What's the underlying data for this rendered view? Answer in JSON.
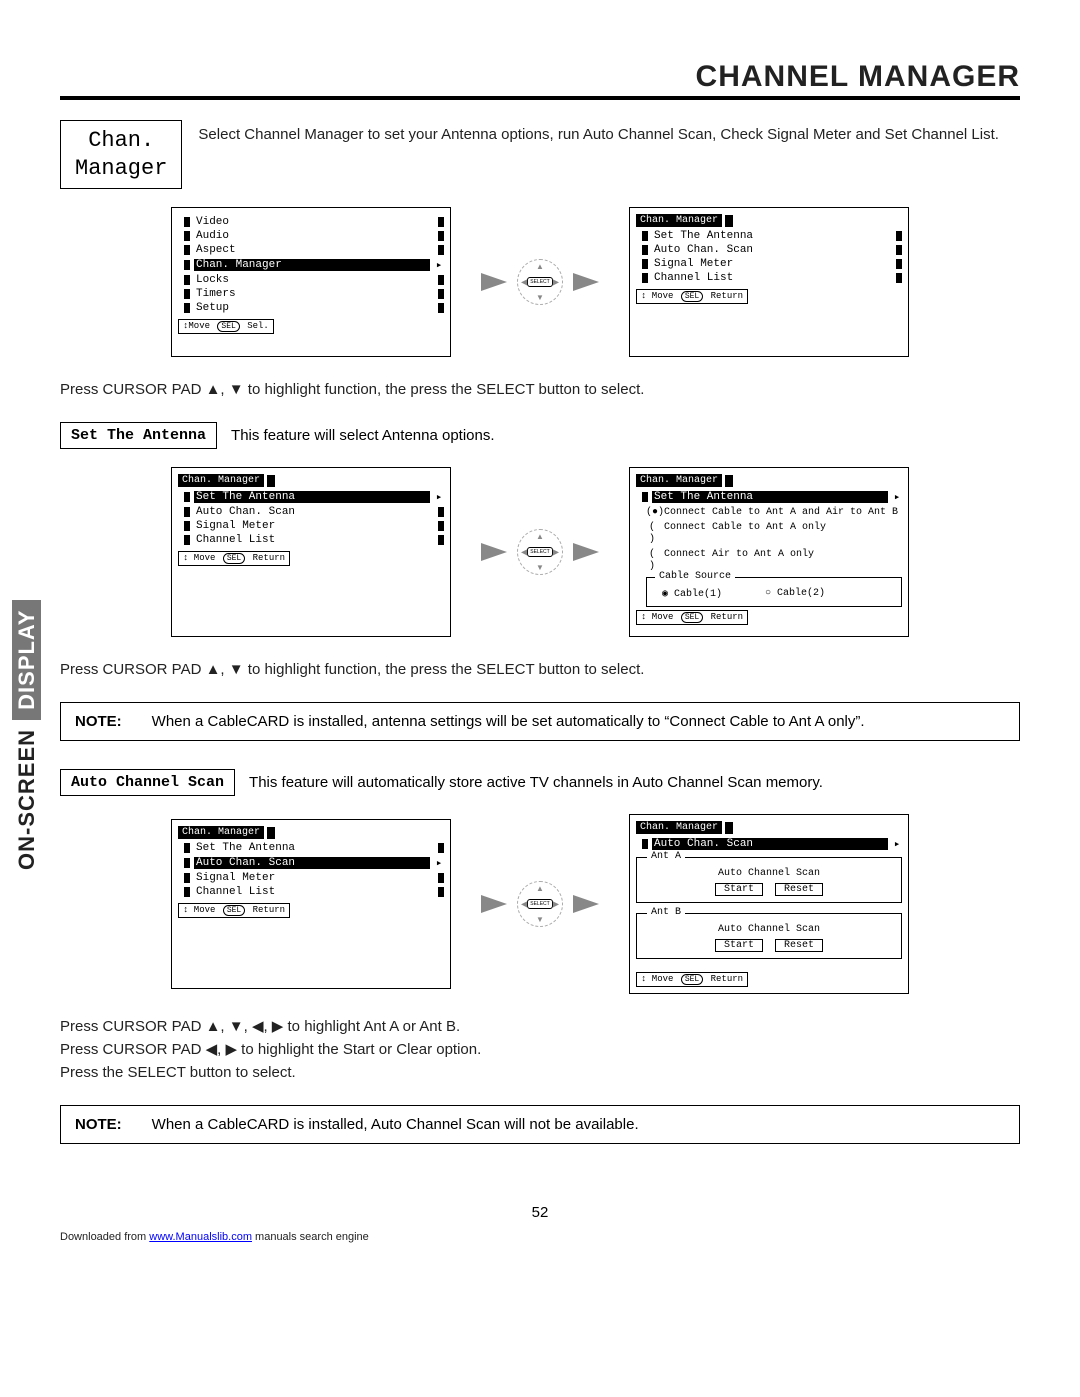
{
  "title": "CHANNEL MANAGER",
  "menu_label": "Chan.\nManager",
  "intro": "Select Channel Manager to set your Antenna options, run Auto Channel Scan, Check Signal Meter and Set Channel List.",
  "side_tab_prefix": "ON-SCREEN",
  "side_tab_suffix": "DISPLAY",
  "select_btn": "SELECT",
  "osd1_left": {
    "header": "",
    "items": [
      "Video",
      "Audio",
      "Aspect",
      "Chan. Manager",
      "Locks",
      "Timers",
      "Setup"
    ],
    "highlight": "Chan. Manager",
    "footer_move": "↕Move",
    "footer_sel_icon": "SEL",
    "footer_sel": "Sel."
  },
  "osd1_right": {
    "header": "Chan. Manager",
    "items": [
      "Set The Antenna",
      "Auto Chan. Scan",
      "Signal Meter",
      "Channel List"
    ],
    "footer_move": "↕ Move",
    "footer_sel_icon": "SEL",
    "footer_sel": "Return"
  },
  "instr1": "Press CURSOR PAD ▲, ▼ to highlight function, the press the SELECT button to select.",
  "sec1_label": "Set The Antenna",
  "sec1_text": "This feature will select Antenna options.",
  "osd2_left": {
    "header": "Chan. Manager",
    "items": [
      "Set The Antenna",
      "Auto Chan. Scan",
      "Signal Meter",
      "Channel List"
    ],
    "highlight": "Set The Antenna",
    "footer_move": "↕ Move",
    "footer_sel_icon": "SEL",
    "footer_sel": "Return"
  },
  "osd2_right": {
    "header": "Chan. Manager",
    "highlight_item": "Set The Antenna",
    "options": [
      {
        "sel": true,
        "text": "Connect Cable to Ant A and Air to Ant B"
      },
      {
        "sel": false,
        "text": "Connect Cable to Ant A only"
      },
      {
        "sel": false,
        "text": "Connect Air to Ant A only"
      }
    ],
    "fieldset_label": "Cable Source",
    "cable1": "Cable(1)",
    "cable2": "Cable(2)",
    "footer_move": "↕ Move",
    "footer_sel_icon": "SEL",
    "footer_sel": "Return"
  },
  "instr2": "Press CURSOR PAD ▲, ▼ to highlight function, the press the SELECT button to select.",
  "note1_label": "NOTE:",
  "note1_text": "When a CableCARD is installed, antenna settings will be set automatically to “Connect Cable to Ant A only”.",
  "sec2_label": "Auto Channel Scan",
  "sec2_text": "This feature will automatically store active TV channels in Auto Channel Scan memory.",
  "osd3_left": {
    "header": "Chan. Manager",
    "items": [
      "Set The Antenna",
      "Auto Chan. Scan",
      "Signal Meter",
      "Channel List"
    ],
    "highlight": "Auto Chan. Scan",
    "footer_move": "↕ Move",
    "footer_sel_icon": "SEL",
    "footer_sel": "Return"
  },
  "osd3_right": {
    "header": "Chan. Manager",
    "highlight_item": "Auto Chan. Scan",
    "ant_a_label": "Ant A",
    "ant_b_label": "Ant B",
    "scan_title": "Auto Channel Scan",
    "btn_start": "Start",
    "btn_reset": "Reset",
    "footer_move": "↕ Move",
    "footer_sel_icon": "SEL",
    "footer_sel": "Return"
  },
  "instr3_line1": "Press CURSOR PAD ▲, ▼, ◀, ▶ to highlight Ant A or Ant B.",
  "instr3_line2": "Press CURSOR PAD ◀, ▶ to highlight the Start or Clear option.",
  "instr3_line3": "Press the SELECT button to select.",
  "note2_label": "NOTE:",
  "note2_text": "When a CableCARD is installed, Auto Channel Scan will not be available.",
  "page_num": "52",
  "dl_prefix": "Downloaded from ",
  "dl_link": "www.Manualslib.com",
  "dl_suffix": " manuals search engine"
}
